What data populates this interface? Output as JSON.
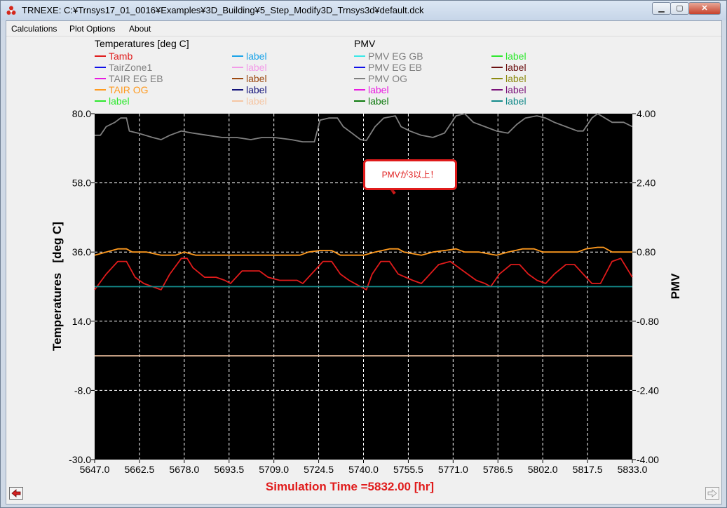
{
  "window": {
    "title": "TRNEXE: C:¥Trnsys17_01_0016¥Examples¥3D_Building¥5_Step_Modify3D_Trnsys3d¥default.dck",
    "min_glyph": "▁",
    "max_glyph": "▢",
    "close_glyph": "✕",
    "app_icon": "trnsys-triangle-icon"
  },
  "menu": [
    {
      "label": "Calculations"
    },
    {
      "label": "Plot Options"
    },
    {
      "label": "About"
    }
  ],
  "nav": {
    "left_icon": "arrow-left-icon",
    "right_icon": "arrow-right-icon"
  },
  "callout": {
    "text": "PMVが3以上！",
    "color": "#e01b1b"
  },
  "chart_data": {
    "type": "line",
    "background": "#000000",
    "grid": true,
    "footer": "Simulation Time =5832.00 [hr]",
    "footer_color": "#e01b1b",
    "left_group_title": "Temperatures   [deg C]",
    "right_group_title": "PMV",
    "ylabel": "Temperatures   [deg C]",
    "y2label": "PMV",
    "xlim": [
      5647.0,
      5833.0
    ],
    "ylim": [
      -30.0,
      80.0
    ],
    "y2lim": [
      -4.0,
      4.0
    ],
    "x_ticks": [
      "5647.0",
      "5662.5",
      "5678.0",
      "5693.5",
      "5709.0",
      "5724.5",
      "5740.0",
      "5755.5",
      "5771.0",
      "5786.5",
      "5802.0",
      "5817.5",
      "5833.0"
    ],
    "y_ticks": [
      "80.0",
      "58.0",
      "36.0",
      "14.0",
      "-8.0",
      "-30.0"
    ],
    "y2_ticks": [
      "4.00",
      "2.40",
      "0.80",
      "-0.80",
      "-2.40",
      "-4.00"
    ],
    "legend": [
      {
        "label": "Tamb",
        "color": "#e01b1b"
      },
      {
        "label": "TairZone1",
        "color": "#808080"
      },
      {
        "label": "TAIR  EG  EB",
        "color": "#808080"
      },
      {
        "label": "TAIR  OG",
        "color": "#ff9a1f"
      },
      {
        "label": "label",
        "color": "#2ee82e"
      },
      {
        "label": "label",
        "color": "#1ba3e8"
      },
      {
        "label": "label",
        "color": "#f29be8"
      },
      {
        "label": "label",
        "color": "#9c4a12"
      },
      {
        "label": "label",
        "color": "#13137a"
      },
      {
        "label": "label",
        "color": "#f5c6a4"
      },
      {
        "label": "PMV  EG  GB",
        "color": "#808080"
      },
      {
        "label": "PMV  EG  EB",
        "color": "#808080"
      },
      {
        "label": "PMV  OG",
        "color": "#808080"
      },
      {
        "label": "label",
        "color": "#e81be0"
      },
      {
        "label": "label",
        "color": "#0e7a0e"
      },
      {
        "label": "label",
        "color": "#2ee82e"
      },
      {
        "label": "label",
        "color": "#6b1010"
      },
      {
        "label": "label",
        "color": "#8c8a10"
      },
      {
        "label": "label",
        "color": "#7a127a"
      },
      {
        "label": "label",
        "color": "#138a8a"
      }
    ],
    "legend_swatches": [
      "#e01b1b",
      "#1010e8",
      "#e81be0",
      "#ff9a1f",
      "#2ee82e",
      "#1ba3e8",
      "#f29be8",
      "#9c4a12",
      "#13137a",
      "#f5c6a4",
      "#3ae8e8",
      "#1010e8",
      "#808080",
      "#e81be0",
      "#0e7a0e",
      "#2ee82e",
      "#6b1010",
      "#8c8a10",
      "#7a127a",
      "#138a8a"
    ],
    "series": [
      {
        "axis": "left",
        "color": "#e01b1b",
        "points": [
          [
            5647,
            24
          ],
          [
            5651,
            29
          ],
          [
            5655,
            33
          ],
          [
            5658,
            33
          ],
          [
            5661,
            28
          ],
          [
            5664,
            26
          ],
          [
            5667,
            25
          ],
          [
            5670,
            24
          ],
          [
            5673,
            29
          ],
          [
            5677,
            34
          ],
          [
            5679,
            34
          ],
          [
            5681,
            31
          ],
          [
            5685,
            28
          ],
          [
            5689,
            28
          ],
          [
            5692,
            27
          ],
          [
            5694,
            26
          ],
          [
            5698,
            30
          ],
          [
            5700,
            30
          ],
          [
            5704,
            30
          ],
          [
            5707,
            28
          ],
          [
            5711,
            27
          ],
          [
            5713,
            27
          ],
          [
            5717,
            27
          ],
          [
            5719,
            26
          ],
          [
            5723,
            30
          ],
          [
            5726,
            33
          ],
          [
            5729,
            33
          ],
          [
            5732,
            29
          ],
          [
            5735,
            27
          ],
          [
            5737,
            26
          ],
          [
            5739,
            25
          ],
          [
            5741,
            24
          ],
          [
            5743,
            29
          ],
          [
            5746,
            33
          ],
          [
            5749,
            33
          ],
          [
            5752,
            29
          ],
          [
            5757,
            27
          ],
          [
            5760,
            26
          ],
          [
            5762,
            28
          ],
          [
            5766,
            32
          ],
          [
            5770,
            33
          ],
          [
            5773,
            31
          ],
          [
            5776,
            29
          ],
          [
            5779,
            27
          ],
          [
            5782,
            26
          ],
          [
            5784,
            25
          ],
          [
            5787,
            29
          ],
          [
            5791,
            32
          ],
          [
            5794,
            32
          ],
          [
            5797,
            29
          ],
          [
            5800,
            27
          ],
          [
            5803,
            26
          ],
          [
            5806,
            29
          ],
          [
            5810,
            32
          ],
          [
            5813,
            32
          ],
          [
            5816,
            29
          ],
          [
            5819,
            26
          ],
          [
            5822,
            26
          ],
          [
            5826,
            33
          ],
          [
            5829,
            34
          ],
          [
            5833,
            28
          ]
        ]
      },
      {
        "axis": "left",
        "color": "#ff9a1f",
        "points": [
          [
            5647,
            35
          ],
          [
            5651,
            36
          ],
          [
            5655,
            37
          ],
          [
            5658,
            37
          ],
          [
            5660,
            36
          ],
          [
            5665,
            36
          ],
          [
            5670,
            35
          ],
          [
            5675,
            35
          ],
          [
            5678,
            36
          ],
          [
            5682,
            35
          ],
          [
            5690,
            35
          ],
          [
            5700,
            35
          ],
          [
            5710,
            35
          ],
          [
            5718,
            35
          ],
          [
            5721,
            36
          ],
          [
            5725,
            36.5
          ],
          [
            5729,
            36.5
          ],
          [
            5732,
            35
          ],
          [
            5740,
            35
          ],
          [
            5744,
            36
          ],
          [
            5749,
            37
          ],
          [
            5752,
            37
          ],
          [
            5754,
            36
          ],
          [
            5760,
            35
          ],
          [
            5764,
            36
          ],
          [
            5768,
            36.5
          ],
          [
            5772,
            37
          ],
          [
            5775,
            36
          ],
          [
            5780,
            36
          ],
          [
            5786,
            35
          ],
          [
            5790,
            36
          ],
          [
            5795,
            37
          ],
          [
            5799,
            37
          ],
          [
            5802,
            36
          ],
          [
            5806,
            36
          ],
          [
            5810,
            36
          ],
          [
            5814,
            36
          ],
          [
            5817,
            37
          ],
          [
            5821,
            37.5
          ],
          [
            5823,
            37.5
          ],
          [
            5826,
            36
          ],
          [
            5833,
            36
          ]
        ]
      },
      {
        "axis": "left",
        "color": "#138a8a",
        "points": [
          [
            5647,
            25
          ],
          [
            5833,
            25
          ]
        ]
      },
      {
        "axis": "left",
        "color": "#f5c6a4",
        "points": [
          [
            5647,
            3
          ],
          [
            5833,
            3
          ]
        ]
      },
      {
        "axis": "right",
        "color": "#808080",
        "points": [
          [
            5647,
            3.5
          ],
          [
            5649,
            3.5
          ],
          [
            5651,
            3.7
          ],
          [
            5654,
            3.8
          ],
          [
            5656,
            3.9
          ],
          [
            5658,
            3.9
          ],
          [
            5659,
            3.6
          ],
          [
            5662,
            3.55
          ],
          [
            5667,
            3.45
          ],
          [
            5670,
            3.4
          ],
          [
            5673,
            3.5
          ],
          [
            5677,
            3.6
          ],
          [
            5681,
            3.55
          ],
          [
            5686,
            3.5
          ],
          [
            5691,
            3.45
          ],
          [
            5696,
            3.45
          ],
          [
            5701,
            3.4
          ],
          [
            5705,
            3.45
          ],
          [
            5709,
            3.45
          ],
          [
            5715,
            3.4
          ],
          [
            5719,
            3.35
          ],
          [
            5723,
            3.35
          ],
          [
            5725,
            3.85
          ],
          [
            5728,
            3.9
          ],
          [
            5731,
            3.9
          ],
          [
            5733,
            3.7
          ],
          [
            5736,
            3.55
          ],
          [
            5739,
            3.4
          ],
          [
            5741,
            3.38
          ],
          [
            5744,
            3.7
          ],
          [
            5747,
            3.9
          ],
          [
            5751,
            3.95
          ],
          [
            5753,
            3.7
          ],
          [
            5756,
            3.6
          ],
          [
            5760,
            3.5
          ],
          [
            5764,
            3.45
          ],
          [
            5768,
            3.55
          ],
          [
            5772,
            3.95
          ],
          [
            5775,
            4.0
          ],
          [
            5778,
            3.8
          ],
          [
            5782,
            3.7
          ],
          [
            5786,
            3.6
          ],
          [
            5790,
            3.55
          ],
          [
            5793,
            3.75
          ],
          [
            5796,
            3.9
          ],
          [
            5800,
            3.95
          ],
          [
            5803,
            3.9
          ],
          [
            5806,
            3.8
          ],
          [
            5810,
            3.7
          ],
          [
            5814,
            3.6
          ],
          [
            5816,
            3.6
          ],
          [
            5819,
            3.9
          ],
          [
            5821,
            4.0
          ],
          [
            5826,
            3.8
          ],
          [
            5830,
            3.8
          ],
          [
            5833,
            3.7
          ]
        ]
      }
    ]
  }
}
